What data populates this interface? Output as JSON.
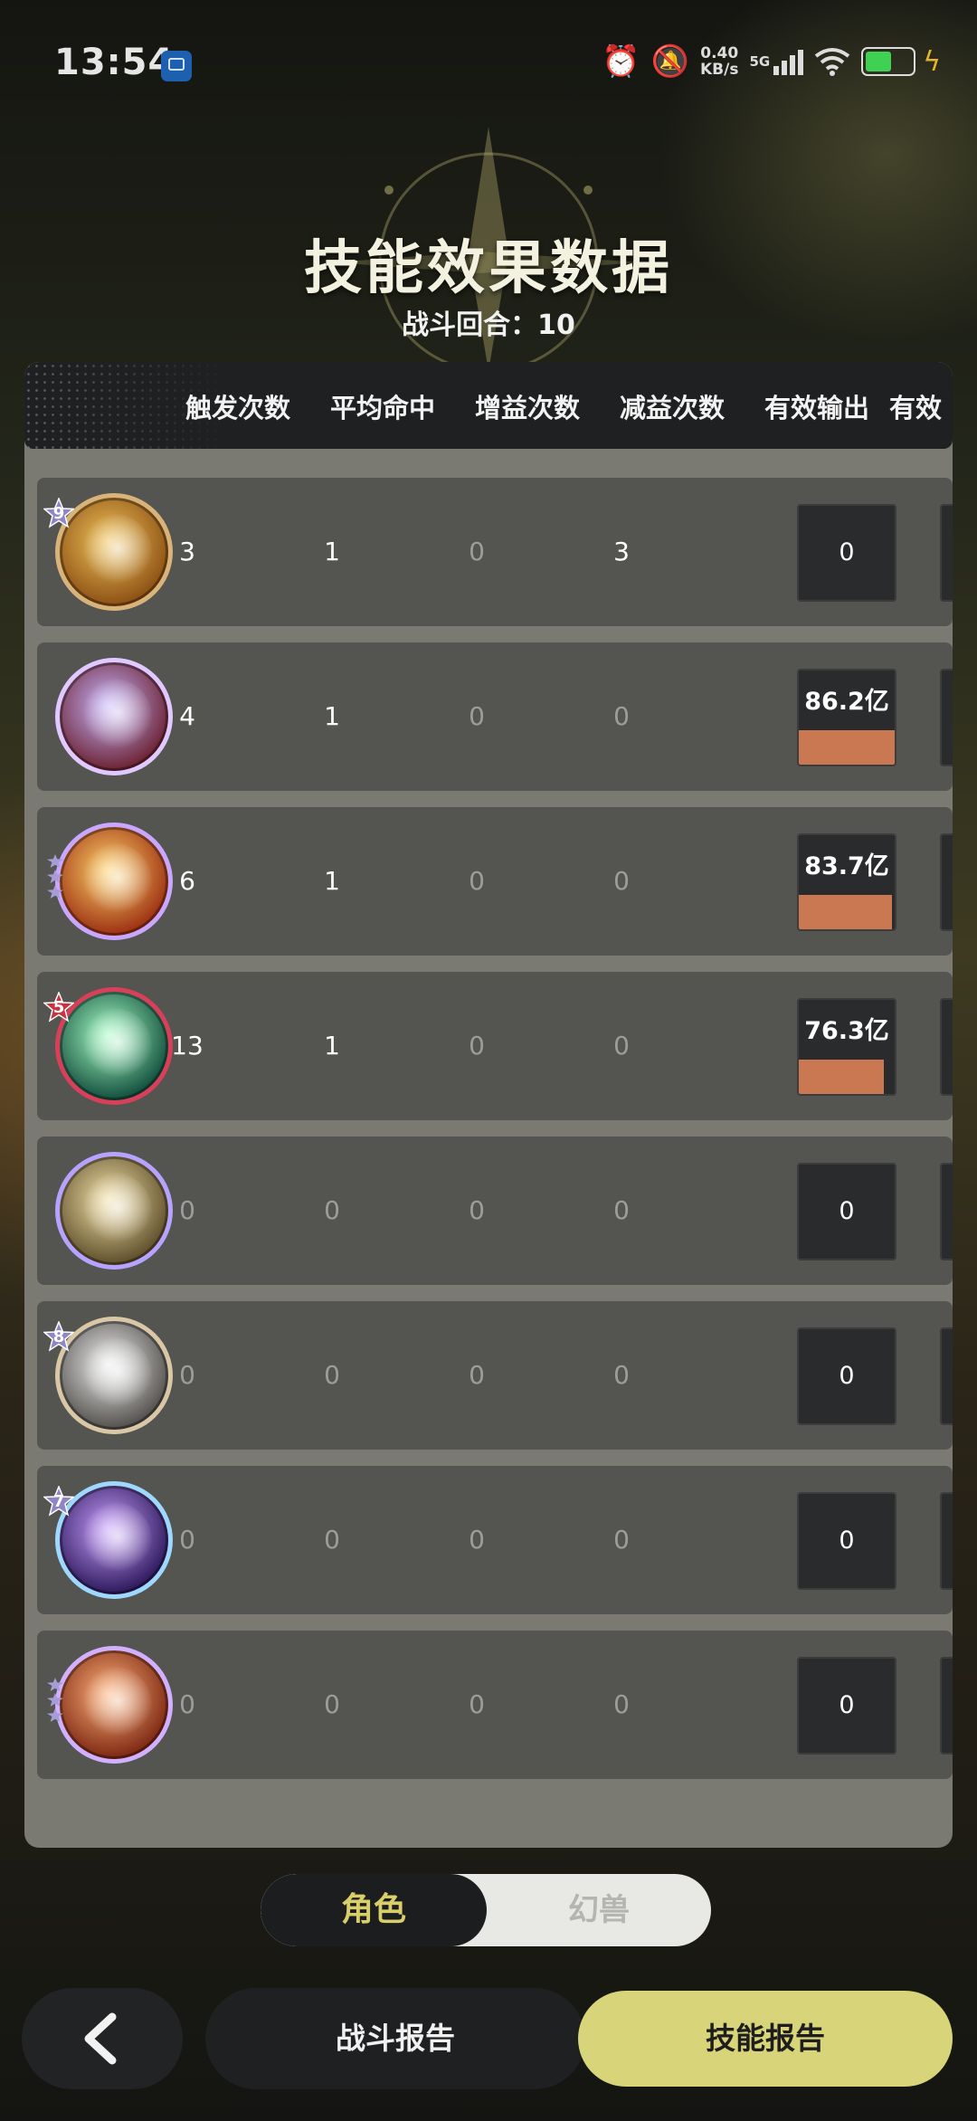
{
  "status_bar": {
    "time": "13:54",
    "net_speed_value": "0.40",
    "net_speed_unit": "KB/s",
    "network": "5G",
    "battery_level": 0.55
  },
  "header": {
    "title": "技能效果数据",
    "rounds": "战斗回合：10"
  },
  "table": {
    "columns": [
      "触发次数",
      "平均命中",
      "增益次数",
      "减益次数",
      "有效输出",
      "有效"
    ],
    "rows": [
      {
        "icon": "crescent-moon-skill-icon",
        "badge": "9",
        "triggers": "3",
        "avg_hit": "1",
        "buffs": "0",
        "debuffs": "3",
        "output": "0",
        "output_fill": 0
      },
      {
        "icon": "lightning-strike-skill-icon",
        "badge": "",
        "triggers": "4",
        "avg_hit": "1",
        "buffs": "0",
        "debuffs": "0",
        "output": "86.2亿",
        "output_fill": 1.0
      },
      {
        "icon": "explosion-skill-icon",
        "badge": "",
        "stars": 3,
        "triggers": "6",
        "avg_hit": "1",
        "buffs": "0",
        "debuffs": "0",
        "output": "83.7亿",
        "output_fill": 0.97
      },
      {
        "icon": "green-comet-skill-icon",
        "badge": "5",
        "triggers": "13",
        "avg_hit": "1",
        "buffs": "0",
        "debuffs": "0",
        "output": "76.3亿",
        "output_fill": 0.89
      },
      {
        "icon": "golden-compass-skill-icon",
        "badge": "",
        "triggers": "0",
        "avg_hit": "0",
        "buffs": "0",
        "debuffs": "0",
        "output": "0",
        "output_fill": 0
      },
      {
        "icon": "dash-figure-skill-icon",
        "badge": "8",
        "triggers": "0",
        "avg_hit": "0",
        "buffs": "0",
        "debuffs": "0",
        "output": "0",
        "output_fill": 0
      },
      {
        "icon": "purple-blade-skill-icon",
        "badge": "7",
        "triggers": "0",
        "avg_hit": "0",
        "buffs": "0",
        "debuffs": "0",
        "output": "0",
        "output_fill": 0
      },
      {
        "icon": "fire-spirit-skill-icon",
        "badge": "",
        "stars": 3,
        "triggers": "0",
        "avg_hit": "0",
        "buffs": "0",
        "debuffs": "0",
        "output": "0",
        "output_fill": 0
      }
    ]
  },
  "toggle": {
    "active": "角色",
    "inactive": "幻兽"
  },
  "footer": {
    "back_icon": "chevron-left-icon",
    "battle_report": "战斗报告",
    "skill_report": "技能报告"
  },
  "colors": {
    "accent": "#d8d47a",
    "output_bar": "#c97852",
    "row_bg": "#545450"
  }
}
